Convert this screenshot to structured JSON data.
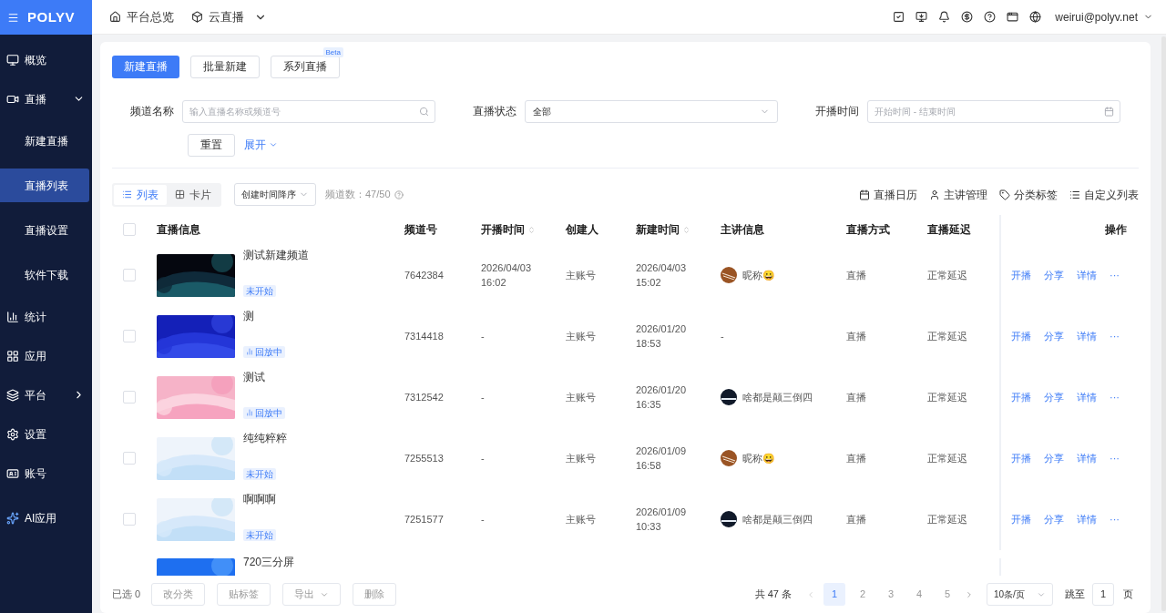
{
  "header": {
    "logo": "POLYV",
    "nav": [
      {
        "label": "平台总览",
        "dropdown": false
      },
      {
        "label": "云直播",
        "dropdown": true
      }
    ],
    "user": "weirui@polyv.net"
  },
  "sidebar": {
    "items": [
      {
        "label": "概览",
        "selected": false
      },
      {
        "label": "直播",
        "expanded": true,
        "selected": false,
        "children": [
          {
            "label": "新建直播",
            "selected": false
          },
          {
            "label": "直播列表",
            "selected": true
          },
          {
            "label": "直播设置",
            "selected": false
          },
          {
            "label": "软件下载",
            "selected": false
          }
        ]
      },
      {
        "label": "统计",
        "selected": false
      },
      {
        "label": "应用",
        "selected": false
      },
      {
        "label": "平台",
        "expanded": false,
        "selected": false
      },
      {
        "label": "设置",
        "selected": false
      },
      {
        "label": "账号",
        "selected": false
      },
      {
        "label": "AI应用",
        "selected": false
      }
    ]
  },
  "actions": [
    {
      "label": "新建直播",
      "primary": true
    },
    {
      "label": "批量新建",
      "primary": false
    },
    {
      "label": "系列直播",
      "primary": false,
      "badge": "Beta"
    }
  ],
  "filters": {
    "name_label": "频道名称",
    "name_placeholder": "输入直播名称或频道号",
    "status_label": "直播状态",
    "status_value": "全部",
    "time_label": "开播时间",
    "time_placeholder": "开始时间 - 结束时间",
    "reset": "重置",
    "expand": "展开"
  },
  "toolbar": {
    "views": [
      {
        "label": "列表",
        "selected": true
      },
      {
        "label": "卡片",
        "selected": false
      }
    ],
    "sort": "创建时间降序",
    "count": "频道数：47/50",
    "tools": [
      "直播日历",
      "主讲管理",
      "分类标签",
      "自定义列表"
    ]
  },
  "table": {
    "all_checked": false,
    "columns": [
      {
        "label": "直播信息",
        "sortable": false
      },
      {
        "label": "频道号",
        "sortable": false
      },
      {
        "label": "开播时间",
        "sortable": true
      },
      {
        "label": "创建人",
        "sortable": false
      },
      {
        "label": "新建时间",
        "sortable": true
      },
      {
        "label": "主讲信息",
        "sortable": false
      },
      {
        "label": "直播方式",
        "sortable": false
      },
      {
        "label": "直播延迟",
        "sortable": false
      },
      {
        "label": "操作",
        "sortable": false
      }
    ],
    "rows": [
      {
        "checked": false,
        "title": "测试新建频道",
        "status": {
          "kind": "not_started",
          "label": "未开始"
        },
        "channel": "7642384",
        "start": [
          "2026/04/03",
          "16:02"
        ],
        "creator": "主账号",
        "created": [
          "2026/04/03",
          "15:02"
        ],
        "host": {
          "name": "昵称😀",
          "kind": "stripes"
        },
        "mode": "直播",
        "delay": "正常延迟",
        "actions": [
          "开播",
          "分享",
          "详情",
          "···"
        ]
      },
      {
        "checked": false,
        "title": "测",
        "status": {
          "kind": "replay",
          "label": "回放中"
        },
        "channel": "7314418",
        "start": [
          "-"
        ],
        "creator": "主账号",
        "created": [
          "2026/01/20",
          "18:53"
        ],
        "host": {
          "name": "-",
          "kind": "plain"
        },
        "mode": "直播",
        "delay": "正常延迟",
        "actions": [
          "开播",
          "分享",
          "详情",
          "···"
        ]
      },
      {
        "checked": false,
        "title": "测试",
        "status": {
          "kind": "replay",
          "label": "回放中"
        },
        "channel": "7312542",
        "start": [
          "-"
        ],
        "creator": "主账号",
        "created": [
          "2026/01/20",
          "16:35"
        ],
        "host": {
          "name": "啥都是颠三倒四",
          "kind": "night"
        },
        "mode": "直播",
        "delay": "正常延迟",
        "actions": [
          "开播",
          "分享",
          "详情",
          "···"
        ]
      },
      {
        "checked": false,
        "title": "纯纯粹粹",
        "status": {
          "kind": "not_started",
          "label": "未开始"
        },
        "channel": "7255513",
        "start": [
          "-"
        ],
        "creator": "主账号",
        "created": [
          "2026/01/09",
          "16:58"
        ],
        "host": {
          "name": "昵称😀",
          "kind": "stripes"
        },
        "mode": "直播",
        "delay": "正常延迟",
        "actions": [
          "开播",
          "分享",
          "详情",
          "···"
        ]
      },
      {
        "checked": false,
        "title": "啊啊啊",
        "status": {
          "kind": "not_started",
          "label": "未开始"
        },
        "channel": "7251577",
        "start": [
          "-"
        ],
        "creator": "主账号",
        "created": [
          "2026/01/09",
          "10:33"
        ],
        "host": {
          "name": "啥都是颠三倒四",
          "kind": "night"
        },
        "mode": "直播",
        "delay": "正常延迟",
        "actions": [
          "开播",
          "分享",
          "详情",
          "···"
        ]
      }
    ],
    "partial_row": {
      "title": "720三分屏"
    }
  },
  "footer": {
    "selected": "已选 0",
    "buttons": [
      {
        "label": "改分类",
        "dropdown": false
      },
      {
        "label": "贴标签",
        "dropdown": false
      },
      {
        "label": "导出",
        "dropdown": true
      },
      {
        "label": "删除",
        "dropdown": false
      }
    ],
    "total": "共 47 条",
    "pages": [
      {
        "label": "1",
        "selected": true
      },
      {
        "label": "2",
        "selected": false
      },
      {
        "label": "3",
        "selected": false
      },
      {
        "label": "4",
        "selected": false
      },
      {
        "label": "5",
        "selected": false
      }
    ],
    "page_size": "10条/页",
    "jump_label": "跳至",
    "jump_value": "1",
    "page_unit": "页"
  }
}
